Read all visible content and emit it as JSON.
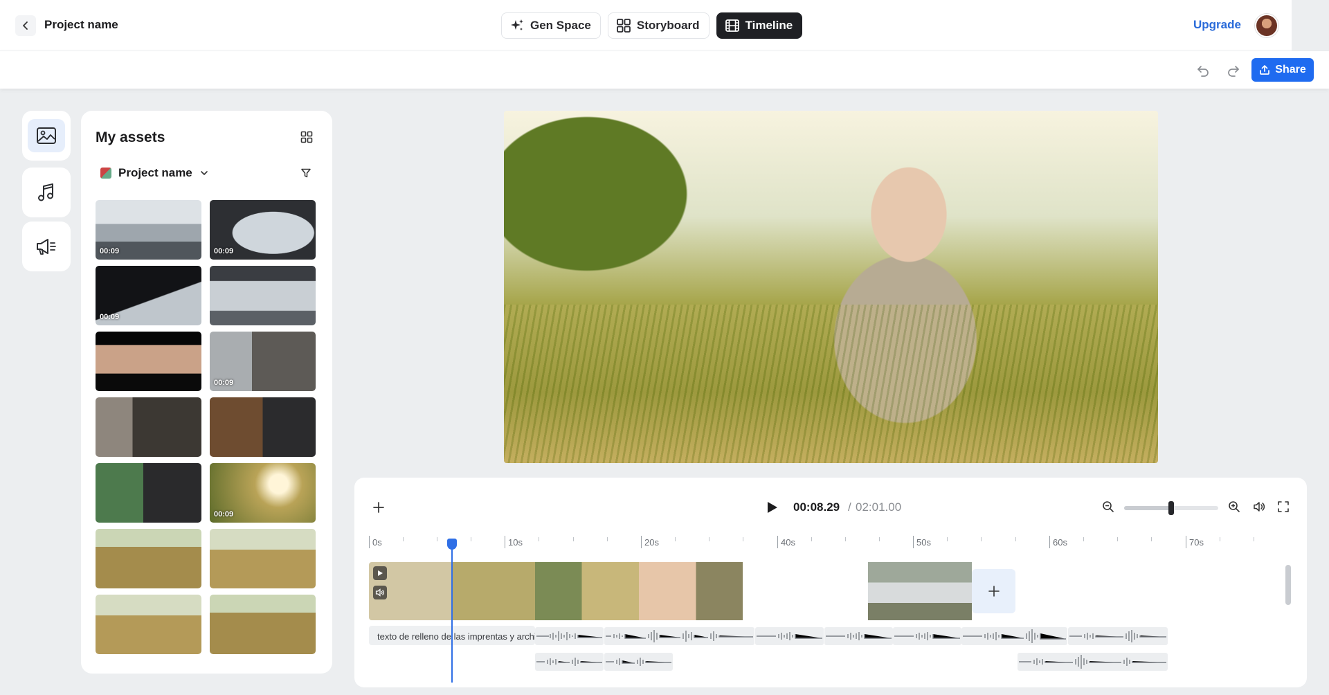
{
  "header": {
    "project_name": "Project name",
    "modes": [
      {
        "label": "Gen Space",
        "icon": "sparkles-icon",
        "active": false
      },
      {
        "label": "Storyboard",
        "icon": "grid-icon",
        "active": false
      },
      {
        "label": "Timeline",
        "icon": "film-icon",
        "active": true
      }
    ],
    "upgrade_label": "Upgrade",
    "share_label": "Share"
  },
  "rail": {
    "items": [
      {
        "name": "images",
        "icon": "image-icon",
        "active": true
      },
      {
        "name": "music",
        "icon": "music-note-icon",
        "active": false
      },
      {
        "name": "voiceover",
        "icon": "megaphone-icon",
        "active": false
      }
    ]
  },
  "assets": {
    "title": "My assets",
    "project_select": "Project name",
    "items": [
      {
        "duration": "00:09"
      },
      {
        "duration": "00:09"
      },
      {
        "duration": "00:09"
      },
      {
        "duration": ""
      },
      {
        "duration": ""
      },
      {
        "duration": "00:09"
      },
      {
        "duration": ""
      },
      {
        "duration": ""
      },
      {
        "duration": ""
      },
      {
        "duration": "00:09"
      },
      {
        "duration": ""
      },
      {
        "duration": ""
      },
      {
        "duration": ""
      },
      {
        "duration": ""
      }
    ]
  },
  "player": {
    "current_time": "00:08.29",
    "separator": "/",
    "total_time": "02:01.00",
    "zoom_level": 0.5
  },
  "timeline": {
    "ruler_labels": [
      "0s",
      "10s",
      "20s",
      "40s",
      "50s",
      "60s",
      "70s"
    ],
    "text_clip": "texto de relleno de las imprentas y archivos de texto"
  },
  "colors": {
    "accent": "#1f6bf0",
    "playhead": "#2f6fe6",
    "active_mode_bg": "#1f2024"
  }
}
